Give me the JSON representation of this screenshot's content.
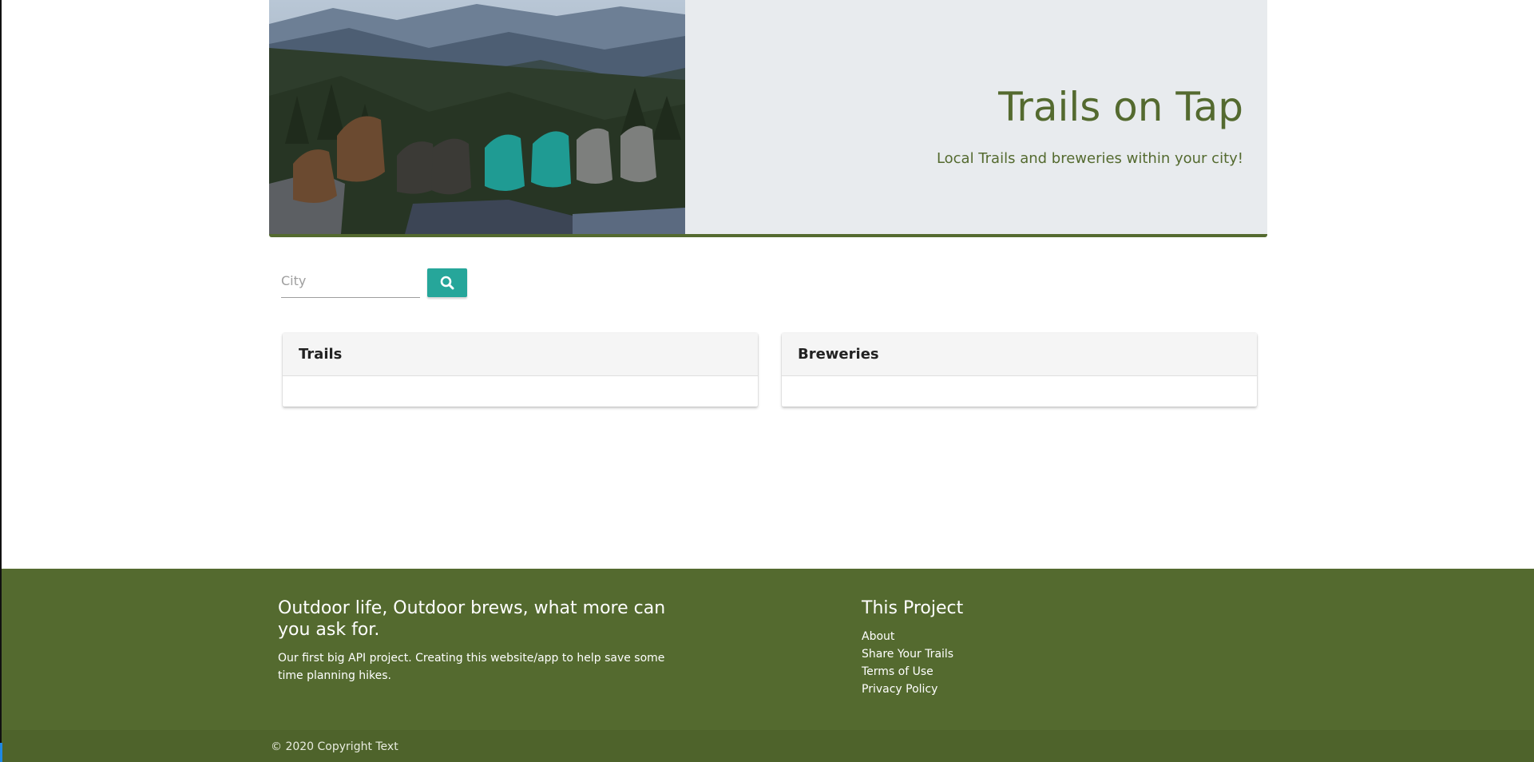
{
  "hero": {
    "image_alt": "Hikers' boots overlooking mountain forest",
    "title": "Trails on Tap",
    "subtitle": "Local Trails and breweries within your city!"
  },
  "search": {
    "placeholder": "City",
    "value": "",
    "button_icon": "search-icon"
  },
  "cards": {
    "trails": {
      "title": "Trails"
    },
    "breweries": {
      "title": "Breweries"
    }
  },
  "footer": {
    "tagline": "Outdoor life, Outdoor brews, what more can you ask for.",
    "description": "Our first big API project. Creating this website/app to help save some time planning hikes.",
    "links_heading": "This Project",
    "links": [
      "About",
      "Share Your Trails",
      "Terms of Use",
      "Privacy Policy"
    ],
    "copyright": "© 2020 Copyright Text"
  },
  "colors": {
    "brand_green": "#546a2f",
    "accent_teal": "#26a69a",
    "hero_bg": "#e8ebee"
  }
}
